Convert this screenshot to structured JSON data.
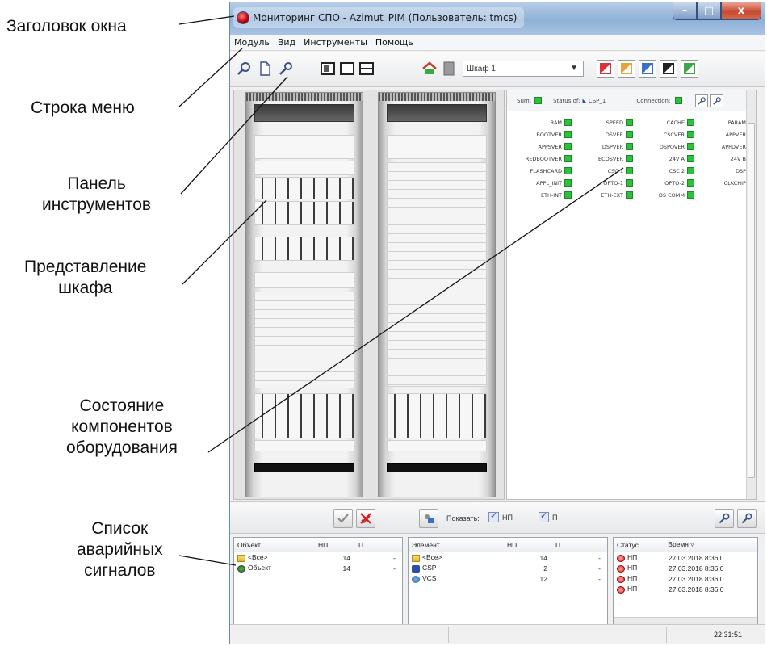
{
  "annotations": {
    "window_title": "Заголовок окна",
    "menu_bar": "Строка меню",
    "toolbar": [
      "Панель",
      "инструментов"
    ],
    "cabinet_view": [
      "Представление",
      "шкафа"
    ],
    "component_status": [
      "Состояние",
      "компонентов",
      "оборудования"
    ],
    "alarm_list": [
      "Список",
      "аварийных",
      "сигналов"
    ]
  },
  "window": {
    "title": "Мониторинг СПО - Azimut_PIM (Пользователь: tmcs)",
    "controls": {
      "minimize": "–",
      "maximize": "□",
      "close": "x"
    }
  },
  "menu": [
    "Модуль",
    "Вид",
    "Инструменты",
    "Помощь"
  ],
  "toolbar": {
    "cabinet_selected": "Шкаф 1",
    "action_colors": [
      "#d8333b",
      "#e8a43c",
      "#3a6fc8",
      "#222222",
      "#3aa843"
    ]
  },
  "status_panel": {
    "header": {
      "sum_label": "Sum:",
      "status_of_label": "Status of:",
      "status_of_value": "CSP_1",
      "connection_label": "Connection:"
    },
    "columns": [
      [
        "RAM",
        "BOOTVER",
        "APPSVER",
        "REDBOOTVER",
        "FLASHCARD",
        "APPL_INIT",
        "ETH-INT"
      ],
      [
        "SPEED",
        "OSVER",
        "DSPVER",
        "ECOSVER",
        "CSC 1",
        "OPTO-1",
        "ETH-EXT"
      ],
      [
        "CACHE",
        "CSCVER",
        "DSPOVER",
        "24V A",
        "CSC 2",
        "OPTO-2",
        "DS COMM"
      ],
      [
        "PARAM",
        "APPVER",
        "APPDVER",
        "24V B",
        "DSP",
        "CLKCHIP"
      ]
    ],
    "ok_color": "#2fbf3f"
  },
  "alarm_toolbar": {
    "show_label": "Показать:",
    "filter_np": "НП",
    "filter_p": "П"
  },
  "object_list": {
    "headers": [
      "Объект",
      "НП",
      "П"
    ],
    "rows": [
      {
        "name": "<Все>",
        "np": "14",
        "p": "-"
      },
      {
        "name": "Объект",
        "np": "14",
        "p": "-"
      }
    ]
  },
  "element_list": {
    "headers": [
      "Элемент",
      "НП",
      "П"
    ],
    "rows": [
      {
        "name": "<Все>",
        "np": "14",
        "p": "-"
      },
      {
        "name": "CSP",
        "np": "2",
        "p": "-"
      },
      {
        "name": "VCS",
        "np": "12",
        "p": "-"
      }
    ]
  },
  "event_list": {
    "headers": [
      "Статус",
      "Время"
    ],
    "sort_indicator": "▿",
    "rows": [
      {
        "status": "НП",
        "time": "27.03.2018 8:36:0"
      },
      {
        "status": "НП",
        "time": "27.03.2018 8:36:0"
      },
      {
        "status": "НП",
        "time": "27.03.2018 8:36:0"
      },
      {
        "status": "НП",
        "time": "27.03.2018 8:36:0"
      }
    ]
  },
  "statusbar": {
    "clock": "22:31:51"
  }
}
